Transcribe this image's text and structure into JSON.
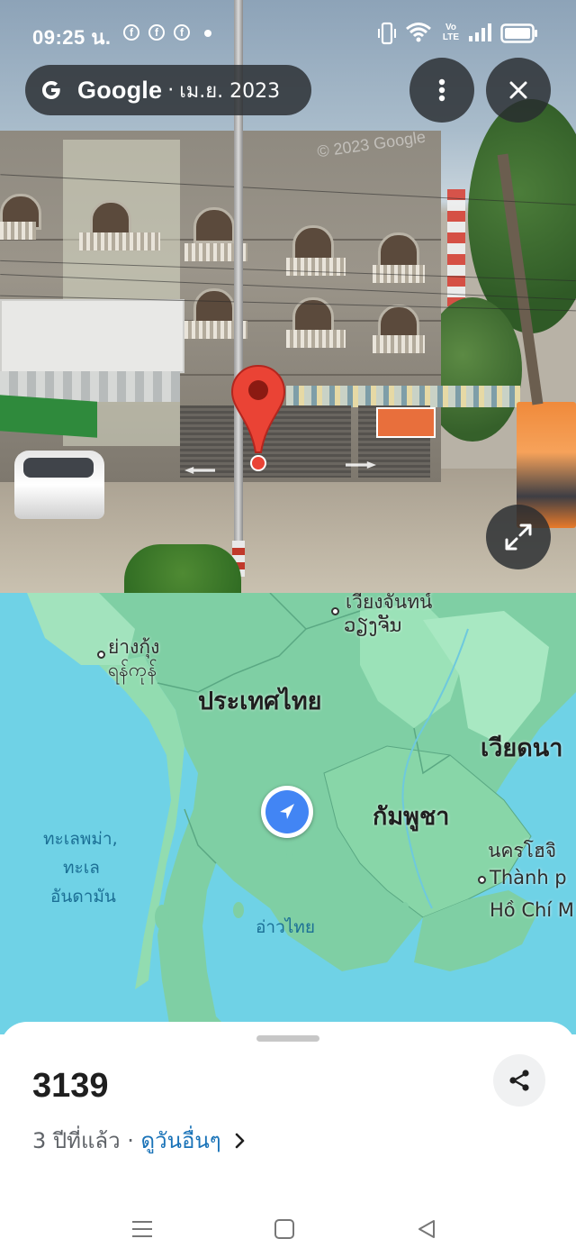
{
  "status_bar": {
    "time": "09:25 น.",
    "notification_icons": [
      "facebook-icon",
      "facebook-icon",
      "facebook-icon"
    ],
    "indicators": [
      "vibrate-icon",
      "wifi-icon",
      "volte-icon",
      "signal-icon",
      "battery-icon"
    ],
    "volte_top": "Vo",
    "volte_bottom": "LTE"
  },
  "header": {
    "brand": "Google",
    "separator": "·",
    "date": "เม.ย. 2023",
    "menu_icon": "more-vert-icon",
    "close_icon": "close-icon"
  },
  "street_view": {
    "watermark": "© 2023 Google",
    "expand_icon": "fullscreen-icon"
  },
  "map": {
    "labels": {
      "city_top": "เวียงจันทน์",
      "city_top_lao": "ວຽງຈັນ",
      "yangon_th": "ย่างกุ้ง",
      "yangon_my": "ရန်ကုန်",
      "thailand": "ประเทศไทย",
      "vietnam": "เวียดนา",
      "cambodia": "กัมพูชา",
      "hcmc_th": "นครโฮจิ",
      "hcmc_vi_1": "Thành p",
      "hcmc_vi_2": "Hồ Chí M",
      "andaman_1": "ทะเลพม่า,",
      "andaman_2": "ทะเล",
      "andaman_3": "อันดามัน",
      "gulf": "อ่าวไทย"
    },
    "colors": {
      "water": "#6fd2e6",
      "land": "#7fcfa4",
      "forest": "#8fdcaa"
    }
  },
  "sheet": {
    "title": "3139",
    "age": "3 ปีที่แล้ว",
    "separator": " · ",
    "link": "ดูวันอื่นๆ",
    "share_icon": "share-icon"
  },
  "system_nav": {
    "menu_icon": "recent-apps-icon",
    "home_icon": "home-icon",
    "back_icon": "back-icon"
  }
}
